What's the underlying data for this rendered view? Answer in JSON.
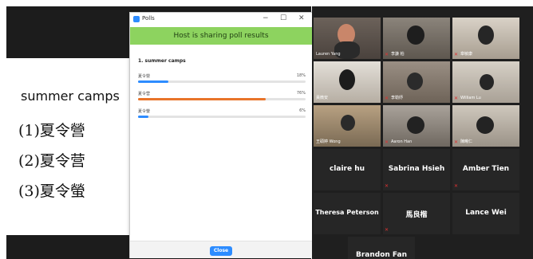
{
  "slide": {
    "title": "summer camps",
    "lines": [
      "(1)夏令營",
      "(2)夏令营",
      "(3)夏令螢"
    ]
  },
  "poll_window": {
    "title": "Polls",
    "banner": "Host is sharing poll results",
    "question": "1. summer camps",
    "options": [
      {
        "label": "夏令營",
        "percent_text": "18%",
        "value": 0.18,
        "color": "#2d8cff"
      },
      {
        "label": "夏令营",
        "percent_text": "76%",
        "value": 0.76,
        "color": "#e8742a"
      },
      {
        "label": "夏令螢",
        "percent_text": "6%",
        "value": 0.06,
        "color": "#2d8cff"
      }
    ],
    "close_label": "Close",
    "controls": {
      "minimize": "−",
      "maximize": "☐",
      "close": "✕"
    }
  },
  "gallery": {
    "video_tiles": [
      {
        "name": "Lauren Yang",
        "muted": false
      },
      {
        "name": "李謙 柏",
        "muted": true
      },
      {
        "name": "章敏康",
        "muted": true
      },
      {
        "name": "黃微安",
        "muted": false
      },
      {
        "name": "李勒妤",
        "muted": true
      },
      {
        "name": "William Lu",
        "muted": true
      },
      {
        "name": "王碩婷 Wong",
        "muted": false
      },
      {
        "name": "Aaron Han",
        "muted": true
      },
      {
        "name": "陳晞仁",
        "muted": true
      }
    ],
    "name_tiles": [
      {
        "name": "claire hu",
        "muted": false
      },
      {
        "name": "Sabrina Hsieh",
        "muted": true
      },
      {
        "name": "Amber Tien",
        "muted": true
      },
      {
        "name": "Theresa Peterson",
        "muted": false
      },
      {
        "name": "馬良楷",
        "muted": true
      },
      {
        "name": "Lance Wei",
        "muted": false
      },
      {
        "name": "Brandon Fan",
        "muted": false
      }
    ]
  },
  "colors": {
    "banner": "#8dd35f",
    "accent": "#2d8cff",
    "orange": "#e8742a",
    "mute": "#e03232"
  }
}
